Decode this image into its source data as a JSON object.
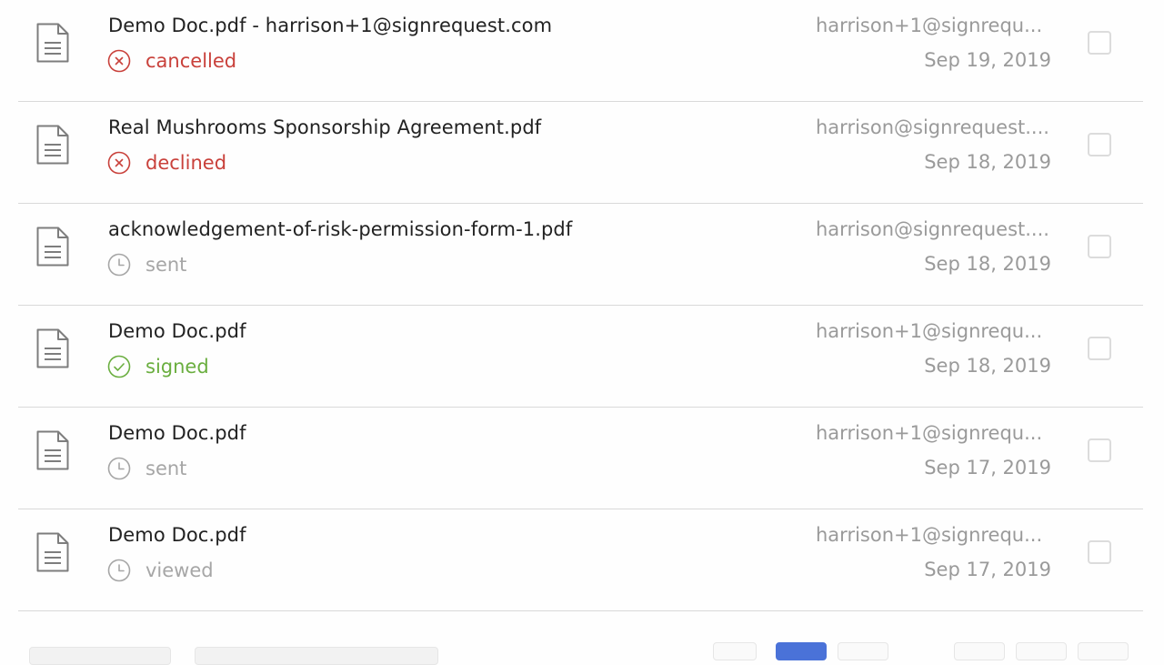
{
  "documents": [
    {
      "title": "Demo Doc.pdf - harrison+1@signrequest.com",
      "status": "cancelled",
      "sender": "harrison+1@signrequ...",
      "date": "Sep 19, 2019"
    },
    {
      "title": "Real Mushrooms Sponsorship Agreement.pdf",
      "status": "declined",
      "sender": "harrison@signrequest....",
      "date": "Sep 18, 2019"
    },
    {
      "title": "acknowledgement-of-risk-permission-form-1.pdf",
      "status": "sent",
      "sender": "harrison@signrequest....",
      "date": "Sep 18, 2019"
    },
    {
      "title": "Demo Doc.pdf",
      "status": "signed",
      "sender": "harrison+1@signrequ...",
      "date": "Sep 18, 2019"
    },
    {
      "title": "Demo Doc.pdf",
      "status": "sent",
      "sender": "harrison+1@signrequ...",
      "date": "Sep 17, 2019"
    },
    {
      "title": "Demo Doc.pdf",
      "status": "viewed",
      "sender": "harrison+1@signrequ...",
      "date": "Sep 17, 2019"
    }
  ],
  "status_styles": {
    "cancelled": {
      "icon": "x-circle-icon",
      "color": "#c9413b"
    },
    "declined": {
      "icon": "x-circle-icon",
      "color": "#c9413b"
    },
    "sent": {
      "icon": "clock-icon",
      "color": "#a6a6a6"
    },
    "viewed": {
      "icon": "clock-icon",
      "color": "#a6a6a6"
    },
    "signed": {
      "icon": "check-circle-icon",
      "color": "#6aae3f"
    }
  },
  "colors": {
    "pagination_active": "#4a72d8",
    "divider": "#d9d9d9"
  }
}
